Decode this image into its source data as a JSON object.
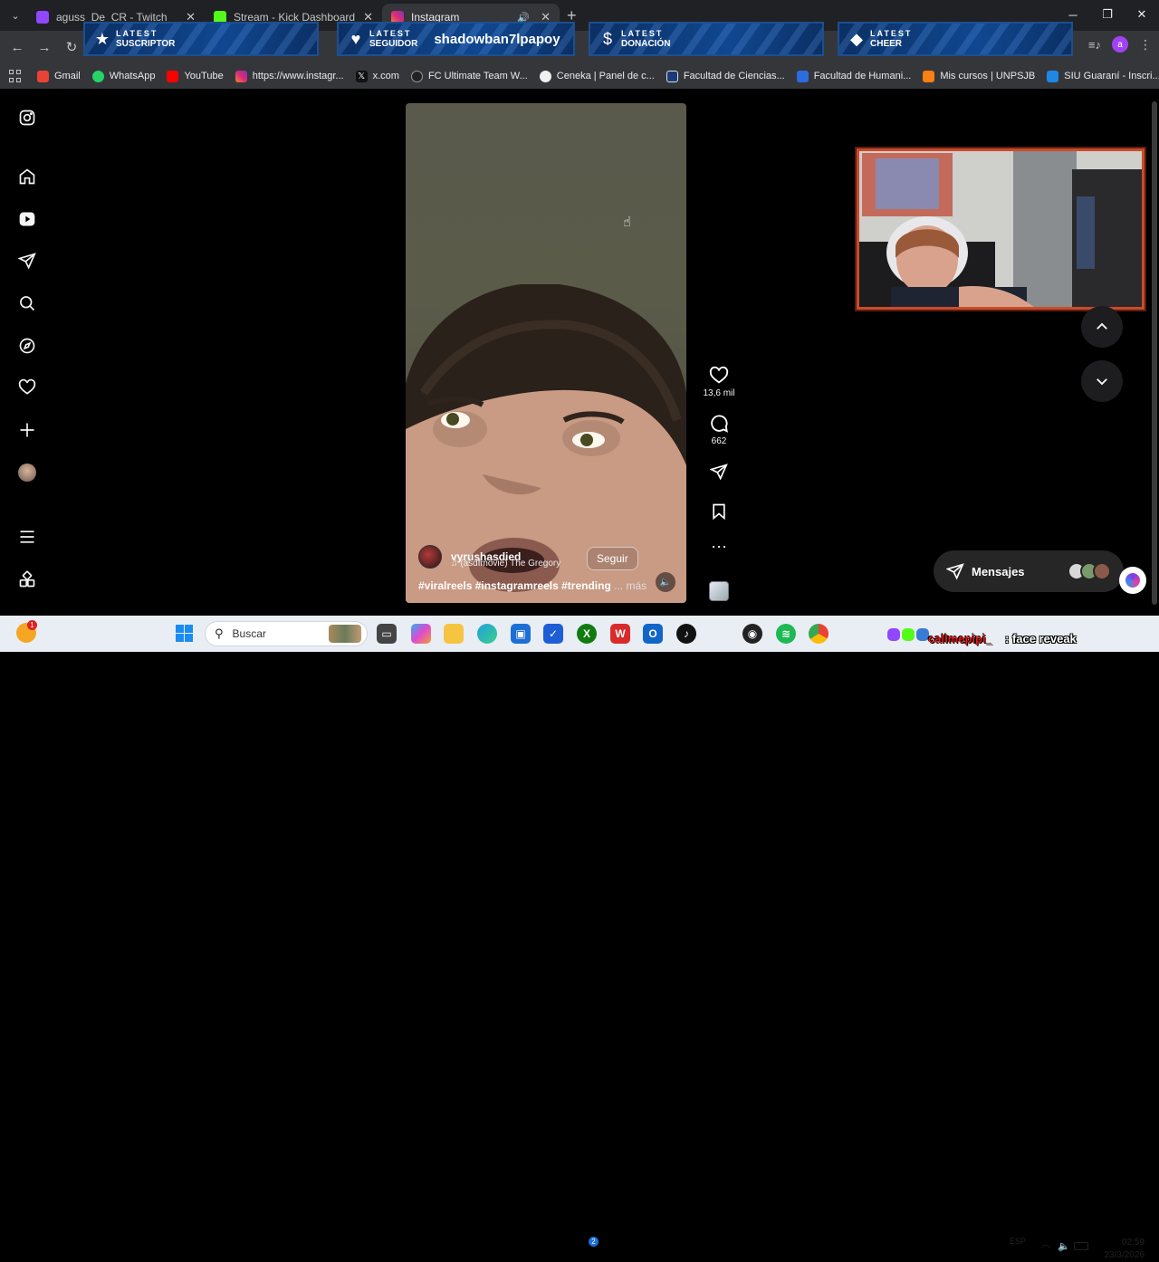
{
  "browser": {
    "tabs": [
      {
        "title": "aguss_De_CR - Twitch",
        "favicon_color": "#9146ff",
        "active": false
      },
      {
        "title": "Stream - Kick Dashboard",
        "favicon_color": "#53fc18",
        "active": false
      },
      {
        "title": "Instagram",
        "favicon_color": "#e1306c",
        "active": true
      }
    ],
    "profile_initial": "a",
    "bookmarks": [
      {
        "label": "Gmail",
        "icon": "gmail-icon",
        "color": "#ea4335"
      },
      {
        "label": "WhatsApp",
        "icon": "whatsapp-icon",
        "color": "#25d366"
      },
      {
        "label": "YouTube",
        "icon": "youtube-icon",
        "color": "#ff0000"
      },
      {
        "label": "https://www.instagr...",
        "icon": "instagram-icon",
        "color": "#e1306c"
      },
      {
        "label": "x.com",
        "icon": "x-icon",
        "color": "#000000"
      },
      {
        "label": "FC Ultimate Team W...",
        "icon": "ea-icon",
        "color": "#222222"
      },
      {
        "label": "Ceneka | Panel de c...",
        "icon": "ceneka-icon",
        "color": "#f0f0f0"
      },
      {
        "label": "Facultad de Ciencias...",
        "icon": "university-icon",
        "color": "#1b3a7a"
      },
      {
        "label": "Facultad de Humani...",
        "icon": "university-icon",
        "color": "#2d6cdf"
      },
      {
        "label": "Mis cursos | UNPSJB",
        "icon": "moodle-icon",
        "color": "#f98012"
      },
      {
        "label": "SIU Guaraní - Inscri...",
        "icon": "siu-icon",
        "color": "#1e88e5"
      }
    ]
  },
  "stream_overlay": {
    "alerts": [
      {
        "line1": "LATEST",
        "line2": "SUSCRIPTOR",
        "name": "",
        "icon": "star-icon"
      },
      {
        "line1": "LATEST",
        "line2": "SEGUIDOR",
        "name": "shadowban7lpapoy",
        "icon": "heart-icon"
      },
      {
        "line1": "LATEST",
        "line2": "DONACIÓN",
        "name": "",
        "icon": "dollar-icon"
      },
      {
        "line1": "LATEST",
        "line2": "CHEER",
        "name": "",
        "icon": "diamond-icon"
      }
    ],
    "ticker_red": "callmepipi_",
    "ticker_white": ": face reveak"
  },
  "reel": {
    "username": "vyrushasdied",
    "audio": "(asdfmovie)  The Gregory",
    "follow_label": "Seguir",
    "caption": "#viralreels #instagramreels #trending",
    "caption_more": "... más",
    "likes": "13,6 mil",
    "comments": "662"
  },
  "messages": {
    "label": "Mensajes"
  },
  "taskbar": {
    "search_placeholder": "Buscar",
    "weather_badge": "1",
    "lang": "ESP",
    "time": "02:59",
    "date": "23/3/2026",
    "xbox_badge": "2"
  }
}
